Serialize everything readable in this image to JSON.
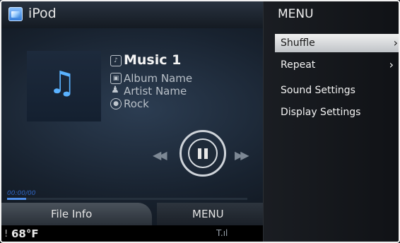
{
  "app": {
    "title": "iPod"
  },
  "track": {
    "title": "Music 1",
    "album": "Album Name",
    "artist": "Artist Name",
    "genre": "Rock"
  },
  "player": {
    "state": "playing",
    "progress": 0.08
  },
  "tabs": {
    "file_info": "File Info",
    "menu": "MENU"
  },
  "status": {
    "temperature": "68°F"
  },
  "menu": {
    "title": "MENU",
    "items": [
      {
        "label": "Shuffle",
        "has_submenu": true,
        "selected": true
      },
      {
        "label": "Repeat",
        "has_submenu": true,
        "selected": false
      },
      {
        "label": "Sound Settings",
        "has_submenu": false,
        "selected": false
      },
      {
        "label": "Display Settings",
        "has_submenu": false,
        "selected": false
      }
    ],
    "chevron": "›"
  },
  "icons": {
    "app": "ipod-app-icon",
    "album": "music-note-icon",
    "prev": "previous-track-icon",
    "pause": "pause-icon",
    "next": "next-track-icon",
    "signal": "signal-strength-icon"
  },
  "colors": {
    "accent": "#4f8ee8",
    "album_note": "#5ab2ff",
    "menu_highlight": "#e6e6e6"
  }
}
